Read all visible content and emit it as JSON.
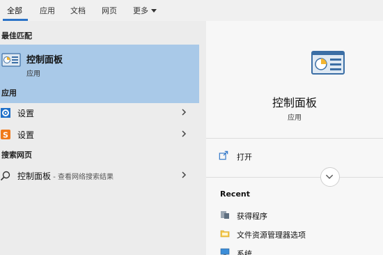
{
  "tabs": [
    {
      "label": "全部"
    },
    {
      "label": "应用"
    },
    {
      "label": "文档"
    },
    {
      "label": "网页"
    },
    {
      "label": "更多"
    }
  ],
  "left": {
    "best_match_heading": "最佳匹配",
    "best_match": {
      "name": "控制面板",
      "type": "应用"
    },
    "apps_heading": "应用",
    "apps": [
      {
        "label": "设置",
        "icon": "gear-icon"
      },
      {
        "label": "设置",
        "icon": "sogou-s-icon"
      }
    ],
    "web_heading": "搜索网页",
    "web_result": {
      "query": "控制面板",
      "hint": " - 查看网络搜索结果"
    }
  },
  "right": {
    "title": "控制面板",
    "subtitle": "应用",
    "open_label": "打开",
    "recent_heading": "Recent",
    "recent_items": [
      {
        "label": "获得程序",
        "icon": "programs-icon"
      },
      {
        "label": "文件资源管理器选项",
        "icon": "folder-options-icon"
      },
      {
        "label": "系统",
        "icon": "system-icon"
      }
    ]
  },
  "colors": {
    "accent": "#2b73c7",
    "selected_bg": "#a9c9e8",
    "left_bg": "#ececec",
    "right_bg": "#f7f7f7"
  }
}
